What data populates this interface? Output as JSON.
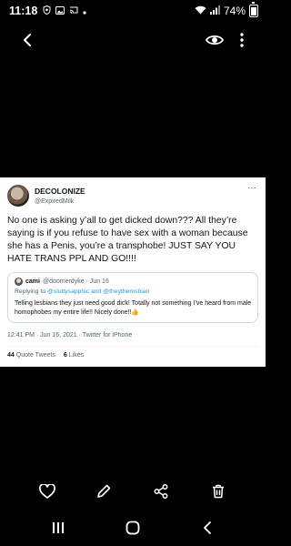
{
  "status": {
    "time": "11:18",
    "battery": "74%",
    "battery_level": 0.74
  },
  "tweet": {
    "display_name": "DECOLONIZE",
    "handle": "@ExpiredMilk",
    "menu": "···",
    "text": "No one is asking y’all to get dicked down??? All they’re saying is if you refuse to have sex with a woman because she has a Penis, you’re a transphobe! JUST SAY YOU HATE TRANS PPL AND GO!!!!",
    "timestamp": "12:41 PM · Jun 16, 2021 · Twitter for iPhone",
    "quote_tweets_count": "44",
    "quote_tweets_label": "Quote Tweets",
    "likes_count": "6",
    "likes_label": "Likes",
    "quote": {
      "name": "cami",
      "handle_date": "@doomerdyke · Jun 16",
      "replying_prefix": "Replying to ",
      "replying_to": "@sluttysapphic and @theythemsbian",
      "text": "Telling lesbians they just need good dick! Totally not something I’ve heard from male homophobes my entire life!! Nicely done!!👍"
    }
  },
  "colors": {
    "link": "#1d9bf0",
    "secondary_text": "#536471"
  },
  "icons": {
    "top_bar": [
      "back-arrow-icon",
      "eye-icon",
      "more-vertical-icon"
    ],
    "actions": [
      "heart-icon",
      "edit-icon",
      "share-icon",
      "trash-icon"
    ],
    "nav": [
      "recent-apps-icon",
      "home-icon",
      "back-icon"
    ]
  }
}
